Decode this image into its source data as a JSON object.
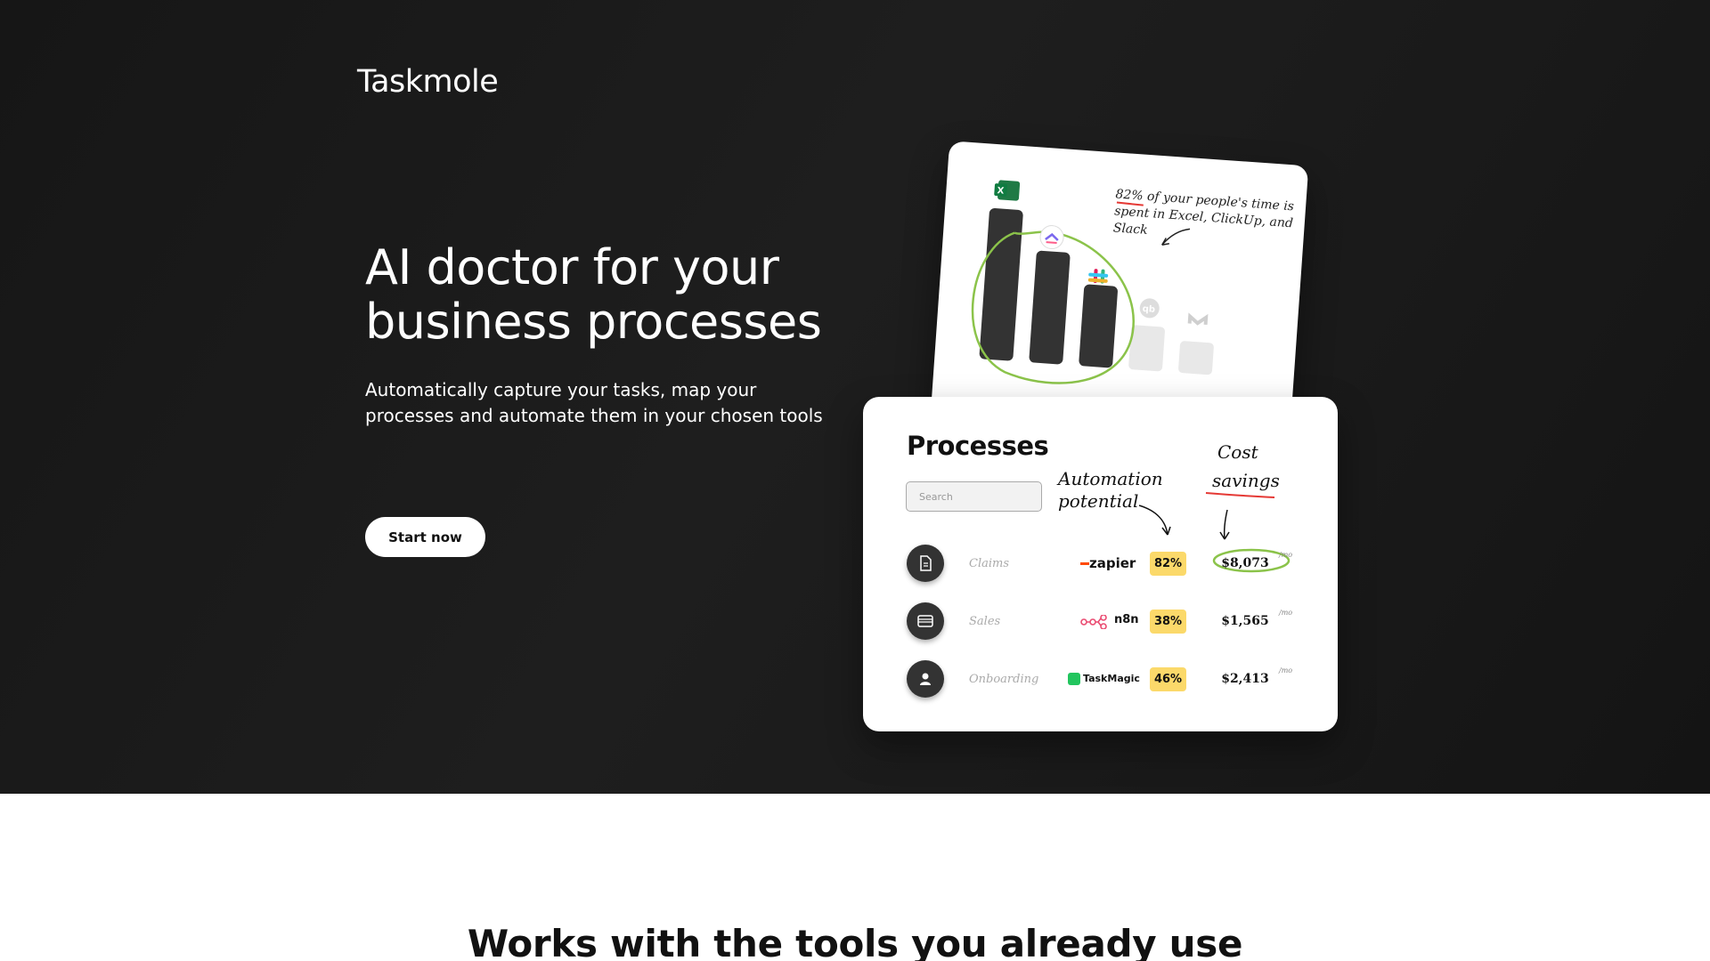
{
  "brand": {
    "name": "Taskmole"
  },
  "hero": {
    "headline": "AI doctor for your business processes",
    "subtitle": "Automatically capture your tasks, map your processes and automate them in your chosen tools",
    "cta_label": "Start now"
  },
  "chart_card": {
    "note": "82% of your people's time is spent in Excel, ClickUp, and Slack",
    "tool_icons": [
      "excel-icon",
      "clickup-icon",
      "slack-icon",
      "quickbooks-icon",
      "gmail-icon"
    ],
    "highlight_color": "#8bc34a"
  },
  "processes": {
    "title": "Processes",
    "search_placeholder": "Search",
    "automation_label": "Automation potential",
    "cost_label_1": "Cost",
    "cost_label_2": "savings",
    "rows": [
      {
        "name": "Claims",
        "tool": "zapier",
        "potential": "82%",
        "savings": "$8,073",
        "period": "/mo",
        "icon": "document-icon"
      },
      {
        "name": "Sales",
        "tool": "n8n",
        "potential": "38%",
        "savings": "$1,565",
        "period": "/mo",
        "icon": "card-icon"
      },
      {
        "name": "Onboarding",
        "tool": "TaskMagic",
        "potential": "46%",
        "savings": "$2,413",
        "period": "/mo",
        "icon": "user-icon"
      }
    ],
    "badge_color": "#fbd96a"
  },
  "tools_section": {
    "heading": "Works with the tools you already use"
  }
}
